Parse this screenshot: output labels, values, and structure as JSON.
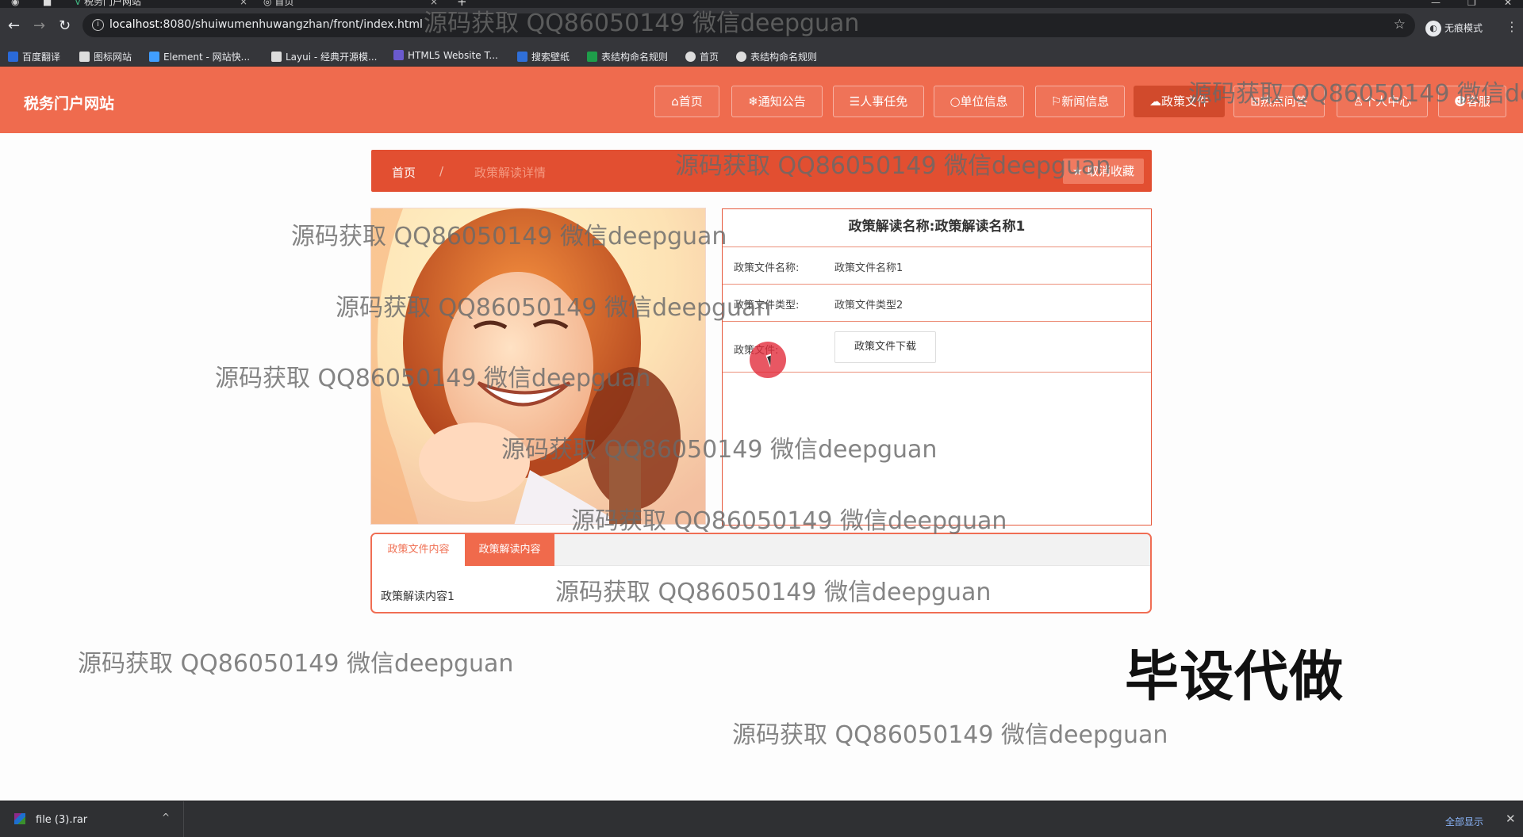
{
  "browser": {
    "tabs": [
      {
        "label": "税务门户网站",
        "close": "×"
      },
      {
        "label": "首页",
        "close": "×"
      }
    ],
    "new_tab": "+",
    "window_controls": [
      "—",
      "❐",
      "✕"
    ],
    "url_host": "localhost",
    "url_rest": ":8080/shuiwumenhuwangzhan/front/index.html",
    "incognito_label": "无痕模式",
    "bookmarks": [
      {
        "label": "百度翻译",
        "color": "#2a6ad8"
      },
      {
        "label": "图标网站",
        "color": "#dddddd"
      },
      {
        "label": "Element - 网站快...",
        "color": "#409eff"
      },
      {
        "label": "Layui - 经典开源模...",
        "color": "#dddddd"
      },
      {
        "label": "HTML5 Website T...",
        "color": "#6a5acd"
      },
      {
        "label": "搜索壁纸",
        "color": "#2f6fd8"
      },
      {
        "label": "表结构命名规则",
        "color": "#1e9e4a"
      },
      {
        "label": "首页",
        "color": "#dddddd"
      },
      {
        "label": "表结构命名规则",
        "color": "#dddddd"
      }
    ]
  },
  "site": {
    "title": "税务门户网站",
    "nav": [
      {
        "icon": "⌂",
        "label": "首页"
      },
      {
        "icon": "❄",
        "label": "通知公告"
      },
      {
        "icon": "☰",
        "label": "人事任免"
      },
      {
        "icon": "○",
        "label": "单位信息"
      },
      {
        "icon": "⚐",
        "label": "新闻信息"
      },
      {
        "icon": "☁",
        "label": "政策文件"
      },
      {
        "icon": "⊞",
        "label": "热点问答"
      },
      {
        "icon": "♙",
        "label": "个人中心"
      },
      {
        "icon": "☻",
        "label": "客服"
      }
    ],
    "accent": "#ef6b4e"
  },
  "breadcrumb": {
    "home": "首页",
    "separator": "/",
    "current": "政策解读详情",
    "fav_button": "取消收藏"
  },
  "detail": {
    "title": "政策解读名称:政策解读名称1",
    "rows": [
      {
        "label": "政策文件名称:",
        "value": "政策文件名称1"
      },
      {
        "label": "政策文件类型:",
        "value": "政策文件类型2"
      },
      {
        "label": "政策文件:",
        "button": "政策文件下载"
      }
    ]
  },
  "tabs": {
    "items": [
      "政策文件内容",
      "政策解读内容"
    ],
    "active_index": 1,
    "body": "政策解读内容1"
  },
  "overlay": {
    "watermark": "源码获取 QQ86050149 微信deepguan",
    "stamp": "毕设代做"
  },
  "downloads": {
    "file": "file (3).rar",
    "show_all": "全部显示",
    "close": "✕"
  }
}
